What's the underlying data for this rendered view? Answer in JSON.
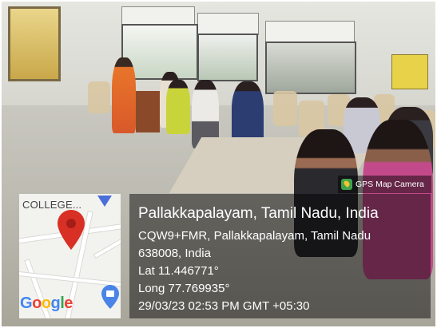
{
  "overlay": {
    "brand_label": "GPS Map Camera",
    "brand_icon": "gps-map-camera-icon",
    "title": "Pallakkapalayam, Tamil Nadu, India",
    "address_line1": "CQW9+FMR, Pallakkapalayam, Tamil Nadu",
    "address_line2": "638008, India",
    "latitude": "Lat 11.446771°",
    "longitude": "Long 77.769935°",
    "timestamp": "29/03/23 02:53 PM GMT +05:30"
  },
  "map": {
    "label": "COLLEGE...",
    "logo_text": "Google",
    "logo_colors": [
      "#4285F4",
      "#EA4335",
      "#FBBC05",
      "#4285F4",
      "#34A853",
      "#EA4335"
    ],
    "pin_color": "#d93025"
  }
}
